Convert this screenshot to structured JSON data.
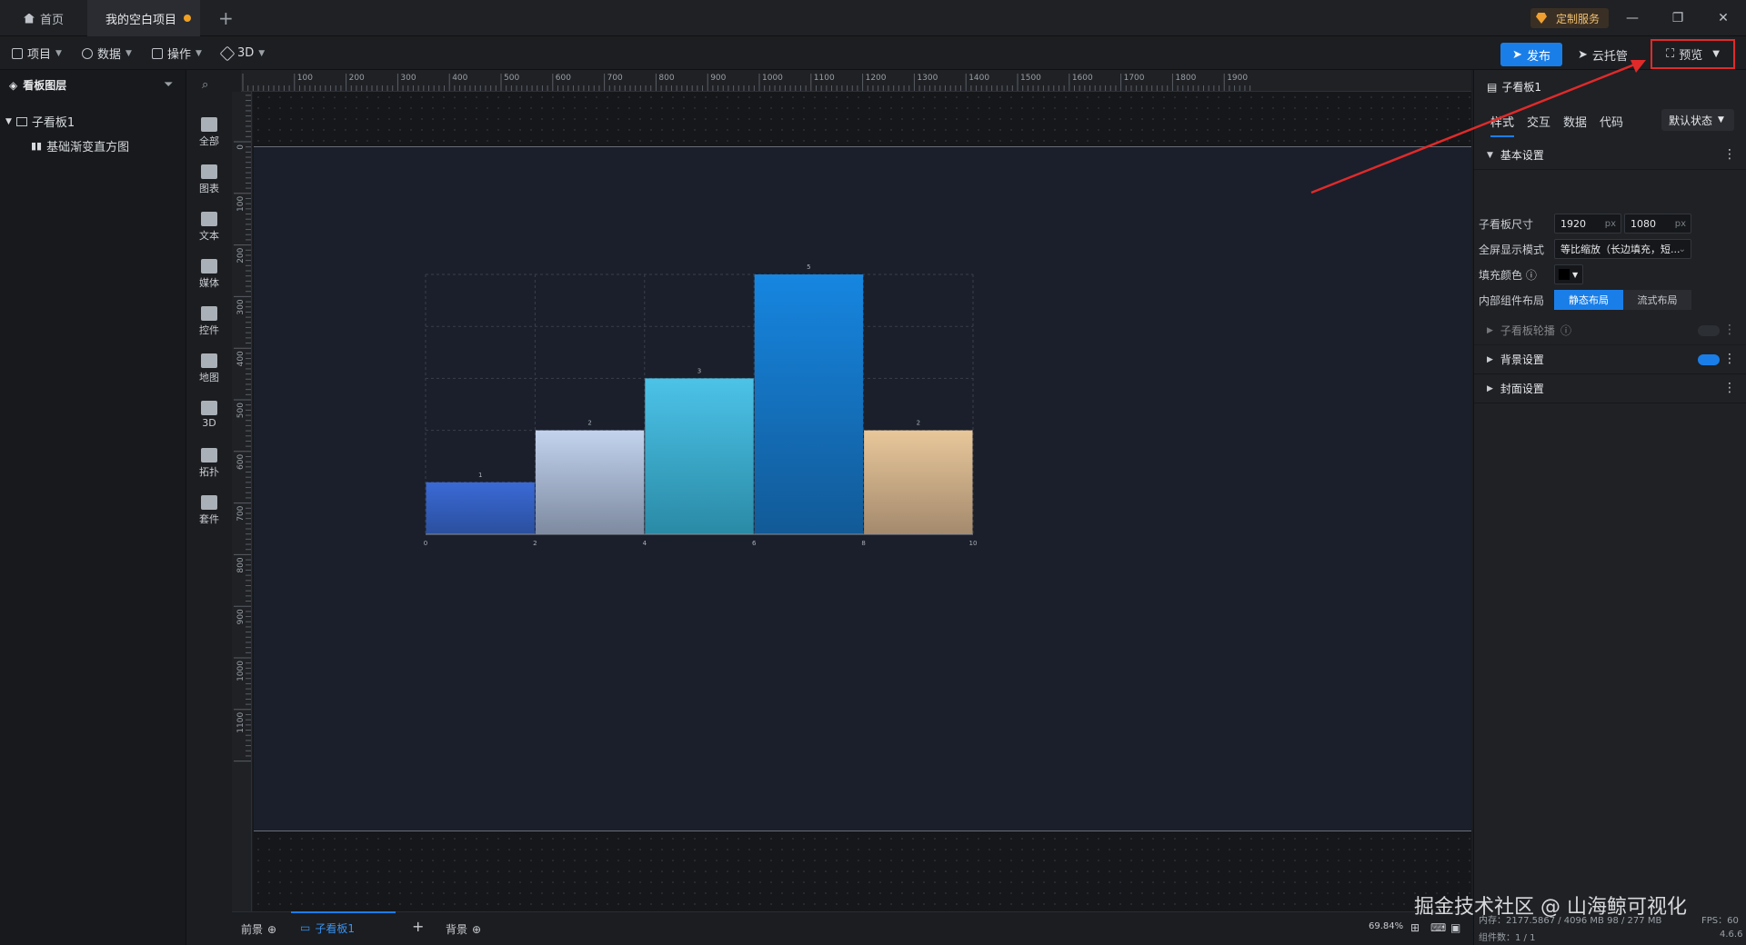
{
  "tabs": {
    "home": "首页",
    "project": "我的空白项目",
    "add": "+"
  },
  "header": {
    "custom_service": "定制服务",
    "minimize": "—",
    "restore": "❐",
    "close": "✕"
  },
  "toolbar": {
    "menus": [
      "项目",
      "数据",
      "操作",
      "3D"
    ],
    "publish": "发布",
    "cloud": "云托管",
    "preview": "预览"
  },
  "layers": {
    "title": "看板图层",
    "tree": [
      {
        "label": "子看板1",
        "level": 0
      },
      {
        "label": "基础渐变直方图",
        "level": 1
      }
    ]
  },
  "categories": [
    "全部",
    "图表",
    "文本",
    "媒体",
    "控件",
    "地图",
    "3D",
    "拓扑",
    "套件"
  ],
  "ruler": {
    "top_ticks": [
      "100",
      "200",
      "300",
      "400",
      "500",
      "600",
      "700",
      "800",
      "900",
      "1000",
      "1100",
      "1200",
      "1300",
      "1400",
      "1500",
      "1600",
      "1700",
      "1800",
      "1900"
    ],
    "left_ticks": [
      "0",
      "100",
      "200",
      "300",
      "400",
      "500",
      "600",
      "700",
      "800",
      "900",
      "1000",
      "1100"
    ]
  },
  "chart_data": {
    "type": "bar",
    "title": "",
    "xlabel": "",
    "ylabel": "",
    "x_ticks": [
      0,
      2,
      4,
      6,
      8,
      10
    ],
    "bins": [
      [
        0,
        2
      ],
      [
        2,
        4
      ],
      [
        4,
        6
      ],
      [
        6,
        8
      ],
      [
        8,
        10
      ]
    ],
    "values": [
      1,
      2,
      3,
      5,
      2
    ],
    "ylim": [
      0,
      5
    ],
    "grid": true,
    "colors": [
      [
        "#3a6ad6",
        "#2b4f9e"
      ],
      [
        "#c3d3ee",
        "#7d8aa0"
      ],
      [
        "#4cc3e8",
        "#2a8aa6"
      ],
      [
        "#1686e0",
        "#125a97"
      ],
      [
        "#e8c79a",
        "#a48a6d"
      ]
    ]
  },
  "bottom": {
    "front": "前景",
    "sub": "子看板1",
    "add": "+",
    "back": "背景",
    "zoom": "69.84%",
    "status": "内存：2177.5867 / 4096 MB 98 / 277 MB",
    "fps": "FPS：60",
    "count": "组件数：1 / 1",
    "version": "4.6.6"
  },
  "panel": {
    "title": "子看板1",
    "tabs": [
      "样式",
      "交互",
      "数据",
      "代码"
    ],
    "state": "默认状态",
    "basic": "基本设置",
    "size_label": "子看板尺寸",
    "width": "1920",
    "height": "1080",
    "unit": "px",
    "fullscreen_label": "全屏显示模式",
    "fullscreen_value": "等比缩放（长边填充，短...",
    "fill_label": "填充颜色",
    "layout_label": "内部组件布局",
    "layout_static": "静态布局",
    "layout_flow": "流式布局",
    "carousel": "子看板轮播",
    "background": "背景设置",
    "cover": "封面设置"
  },
  "watermark": "掘金技术社区 @ 山海鲸可视化"
}
